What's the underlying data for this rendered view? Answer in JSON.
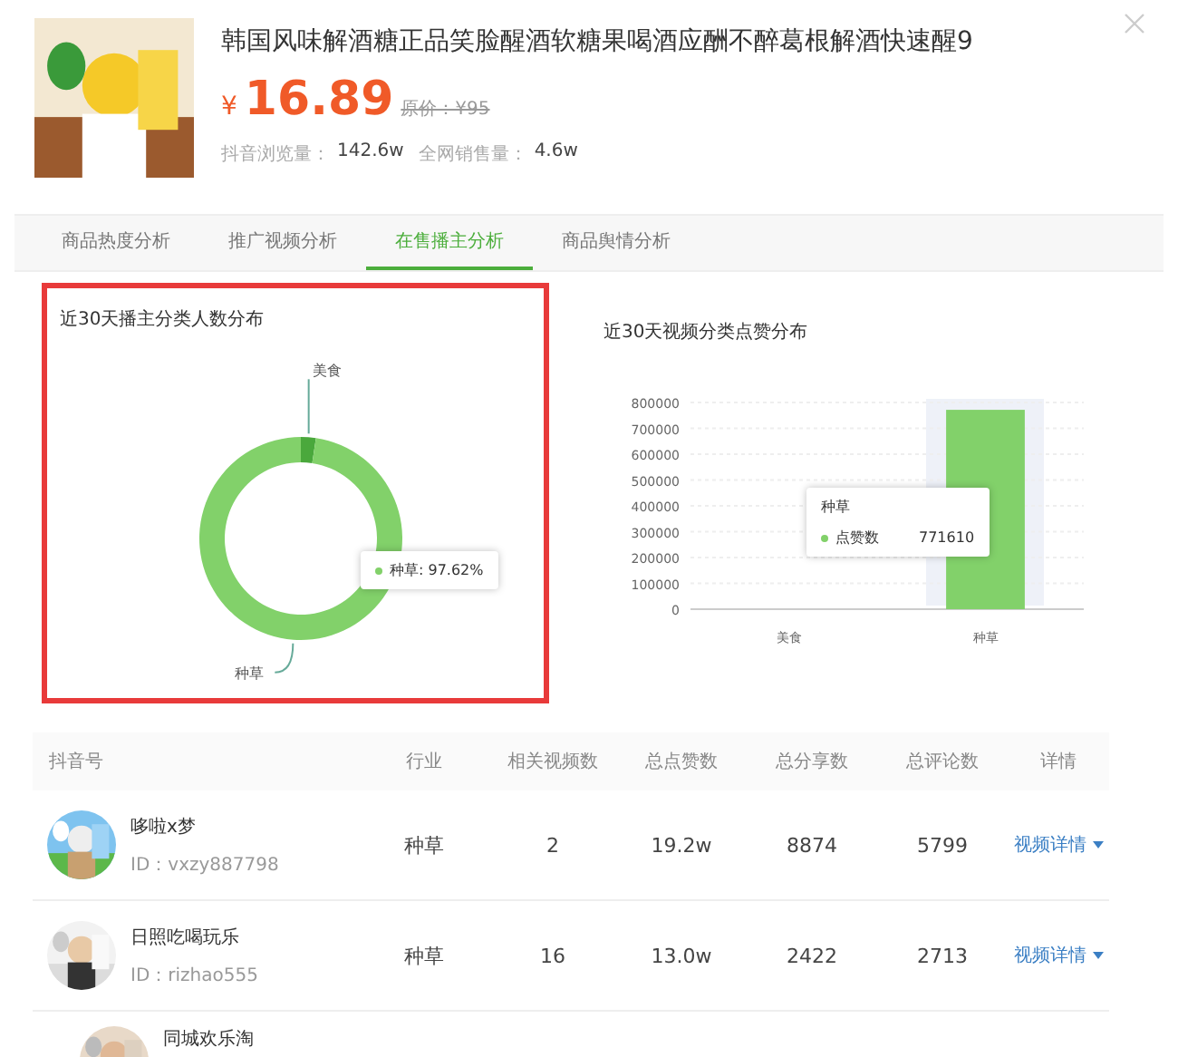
{
  "product": {
    "title": "韩国风味解酒糖正品笑脸醒酒软糖果喝酒应酬不醉葛根解酒快速醒9",
    "currency": "¥",
    "price": "16.89",
    "original_price": "原价：¥95",
    "stats": [
      {
        "label": "抖音浏览量：",
        "value": "142.6w"
      },
      {
        "label": "全网销售量：",
        "value": "4.6w"
      }
    ]
  },
  "tabs": [
    {
      "label": "商品热度分析",
      "selected": false
    },
    {
      "label": "推广视频分析",
      "selected": false
    },
    {
      "label": "在售播主分析",
      "selected": true
    },
    {
      "label": "商品舆情分析",
      "selected": false
    }
  ],
  "left_chart": {
    "title": "近30天播主分类人数分布",
    "highlighted": true,
    "tooltip": "种草: 97.62%",
    "chart_data": {
      "type": "donut",
      "categories": [
        "美食",
        "种草"
      ],
      "values": [
        2.38,
        97.62
      ]
    }
  },
  "right_chart": {
    "title": "近30天视频分类点赞分布",
    "tooltip": {
      "title": "种草",
      "value": "771610"
    },
    "chart_data": {
      "type": "bar",
      "categories": [
        "美食",
        "种草"
      ],
      "series": [
        {
          "name": "点赞数",
          "color": "#82d16a",
          "values": [
            0,
            771610
          ]
        }
      ],
      "grid": true,
      "ylim": [
        0,
        800000
      ],
      "yticks": [
        0,
        100000,
        200000,
        300000,
        400000,
        500000,
        600000,
        700000,
        800000
      ]
    }
  },
  "table": {
    "columns": [
      "抖音号",
      "行业",
      "相关视频数",
      "总点赞数",
      "总分享数",
      "总评论数",
      "详情"
    ],
    "rows": [
      {
        "name": "哆啦x梦",
        "id": "ID：vxzy887798",
        "industry": "种草",
        "videos": "2",
        "likes": "19.2w",
        "shares": "8874",
        "comments": "5799",
        "detail": "视频详情"
      },
      {
        "name": "日照吃喝玩乐",
        "id": "ID：rizhao555",
        "industry": "种草",
        "videos": "16",
        "likes": "13.0w",
        "shares": "2422",
        "comments": "2713",
        "detail": "视频详情"
      },
      {
        "name": "同城欢乐淘"
      }
    ]
  }
}
